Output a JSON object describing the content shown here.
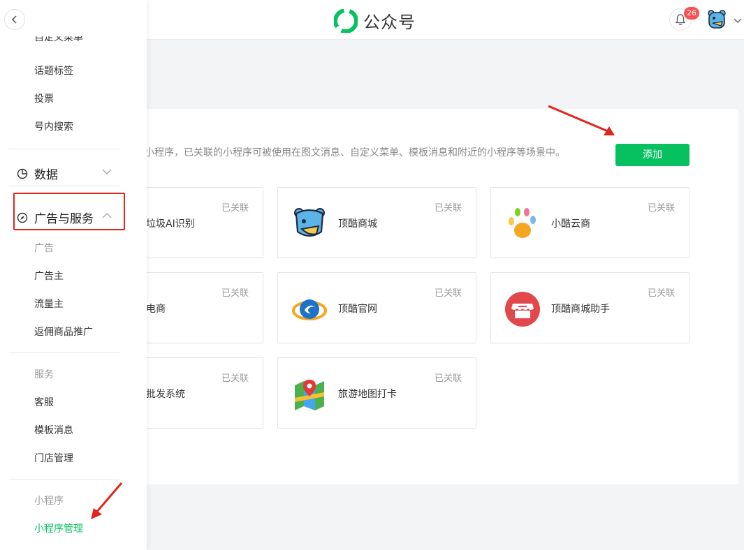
{
  "header": {
    "app_title": "公众号",
    "notification_count": "26"
  },
  "sidebar": {
    "partial_top_item": "自定义菜单",
    "items_top": [
      {
        "label": "话题标签"
      },
      {
        "label": "投票"
      },
      {
        "label": "号内搜索"
      }
    ],
    "group_data": {
      "label": "数据"
    },
    "group_ads": {
      "label": "广告与服务"
    },
    "sections": [
      {
        "title": "广告",
        "items": [
          "广告主",
          "流量主",
          "返佣商品推广"
        ]
      },
      {
        "title": "服务",
        "items": [
          "客服",
          "模板消息",
          "门店管理"
        ]
      },
      {
        "title": "小程序",
        "items": [
          "小程序管理"
        ]
      }
    ]
  },
  "main": {
    "description": "小程序，已关联的小程序可被使用在图文消息、自定义菜单、模板消息和附近的小程序等场景中。",
    "add_button_label": "添加",
    "cards": [
      {
        "name": "垃圾AI识别",
        "status": "已关联"
      },
      {
        "name": "顶酷商城",
        "status": "已关联",
        "icon": "bear-icon"
      },
      {
        "name": "小酷云商",
        "status": "已关联",
        "icon": "paw-icon"
      },
      {
        "name": "电商",
        "status": "已关联"
      },
      {
        "name": "顶酷官网",
        "status": "已关联",
        "icon": "swirl-logo-icon"
      },
      {
        "name": "顶酷商城助手",
        "status": "已关联",
        "icon": "shop-icon"
      },
      {
        "name": "批发系统",
        "status": "已关联"
      },
      {
        "name": "旅游地图打卡",
        "status": "已关联",
        "icon": "map-pin-icon"
      }
    ]
  },
  "colors": {
    "accent": "#07c160",
    "badge": "#fa5151",
    "annotation_red": "#e1251b"
  }
}
